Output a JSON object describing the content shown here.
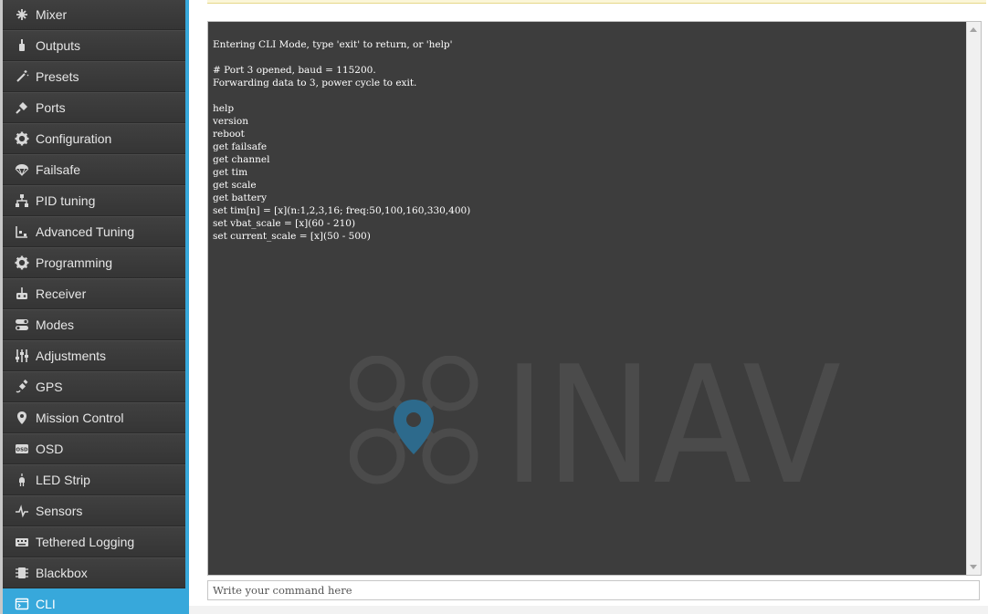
{
  "sidebar": {
    "accent_color": "#37a8db",
    "items": [
      {
        "label": "Mixer",
        "icon": "mixer-icon",
        "active": false
      },
      {
        "label": "Outputs",
        "icon": "motor-icon",
        "active": false
      },
      {
        "label": "Presets",
        "icon": "wand-icon",
        "active": false
      },
      {
        "label": "Ports",
        "icon": "plug-icon",
        "active": false
      },
      {
        "label": "Configuration",
        "icon": "gear-icon",
        "active": false
      },
      {
        "label": "Failsafe",
        "icon": "parachute-icon",
        "active": false
      },
      {
        "label": "PID tuning",
        "icon": "network-icon",
        "active": false
      },
      {
        "label": "Advanced Tuning",
        "icon": "tuning-icon",
        "active": false
      },
      {
        "label": "Programming",
        "icon": "gear-icon",
        "active": false
      },
      {
        "label": "Receiver",
        "icon": "receiver-icon",
        "active": false
      },
      {
        "label": "Modes",
        "icon": "modes-icon",
        "active": false
      },
      {
        "label": "Adjustments",
        "icon": "sliders-icon",
        "active": false
      },
      {
        "label": "GPS",
        "icon": "satellite-icon",
        "active": false
      },
      {
        "label": "Mission Control",
        "icon": "map-pin-icon",
        "active": false
      },
      {
        "label": "OSD",
        "icon": "osd-icon",
        "active": false
      },
      {
        "label": "LED Strip",
        "icon": "led-icon",
        "active": false
      },
      {
        "label": "Sensors",
        "icon": "pulse-icon",
        "active": false
      },
      {
        "label": "Tethered Logging",
        "icon": "logging-icon",
        "active": false
      },
      {
        "label": "Blackbox",
        "icon": "chip-icon",
        "active": false
      },
      {
        "label": "CLI",
        "icon": "terminal-icon",
        "active": true
      }
    ]
  },
  "console": {
    "watermark": "INAV",
    "watermark_color": "#4b4b4b",
    "lines": [
      "Entering CLI Mode, type 'exit' to return, or 'help'",
      "",
      "# Port 3 opened, baud = 115200.",
      "Forwarding data to 3, power cycle to exit.",
      "",
      "help",
      "version",
      "reboot",
      "get failsafe",
      "get channel",
      "get tim",
      "get scale",
      "get battery",
      "set tim[n] = [x](n:1,2,3,16; freq:50,100,160,330,400)",
      "set vbat_scale = [x](60 - 210)",
      "set current_scale = [x](50 - 500)"
    ]
  },
  "command_input": {
    "placeholder": "Write your command here",
    "value": ""
  }
}
